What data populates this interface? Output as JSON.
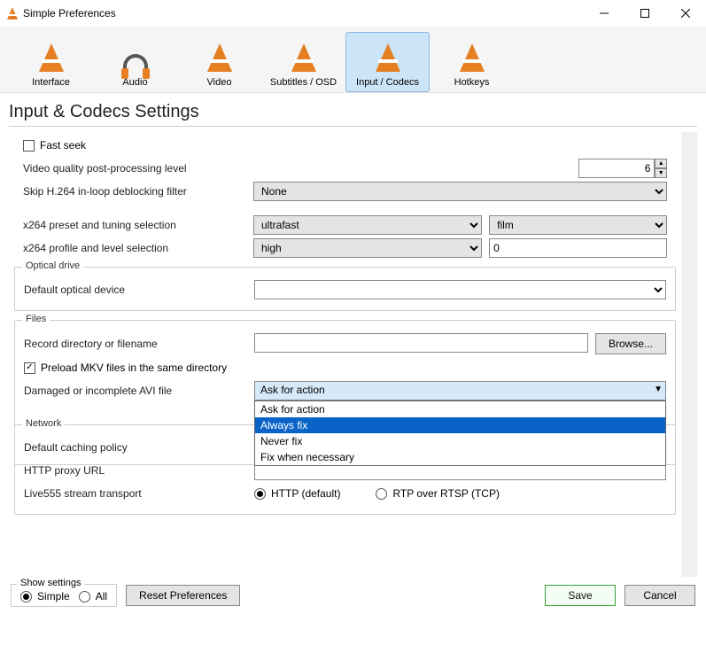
{
  "window": {
    "title": "Simple Preferences"
  },
  "tabs": [
    {
      "label": "Interface"
    },
    {
      "label": "Audio"
    },
    {
      "label": "Video"
    },
    {
      "label": "Subtitles / OSD"
    },
    {
      "label": "Input / Codecs"
    },
    {
      "label": "Hotkeys"
    }
  ],
  "page_title": "Input & Codecs Settings",
  "codecs": {
    "fast_seek_label": "Fast seek",
    "quality_label": "Video quality post-processing level",
    "quality_value": "6",
    "skip_label": "Skip H.264 in-loop deblocking filter",
    "skip_value": "None",
    "preset_label": "x264 preset and tuning selection",
    "preset_value": "ultrafast",
    "tune_value": "film",
    "profile_label": "x264 profile and level selection",
    "profile_value": "high",
    "level_value": "0"
  },
  "optical": {
    "legend": "Optical drive",
    "default_label": "Default optical device",
    "default_value": ""
  },
  "files": {
    "legend": "Files",
    "record_label": "Record directory or filename",
    "record_value": "",
    "browse_label": "Browse...",
    "preload_label": "Preload MKV files in the same directory",
    "avi_label": "Damaged or incomplete AVI file",
    "avi_value": "Ask for action",
    "avi_options": [
      "Ask for action",
      "Always fix",
      "Never fix",
      "Fix when necessary"
    ]
  },
  "network": {
    "legend": "Network",
    "caching_label": "Default caching policy",
    "proxy_label": "HTTP proxy URL",
    "proxy_value": "",
    "live555_label": "Live555 stream transport",
    "http_label": "HTTP (default)",
    "rtp_label": "RTP over RTSP (TCP)"
  },
  "footer": {
    "show_settings_label": "Show settings",
    "simple_label": "Simple",
    "all_label": "All",
    "reset_label": "Reset Preferences",
    "save_label": "Save",
    "cancel_label": "Cancel"
  }
}
